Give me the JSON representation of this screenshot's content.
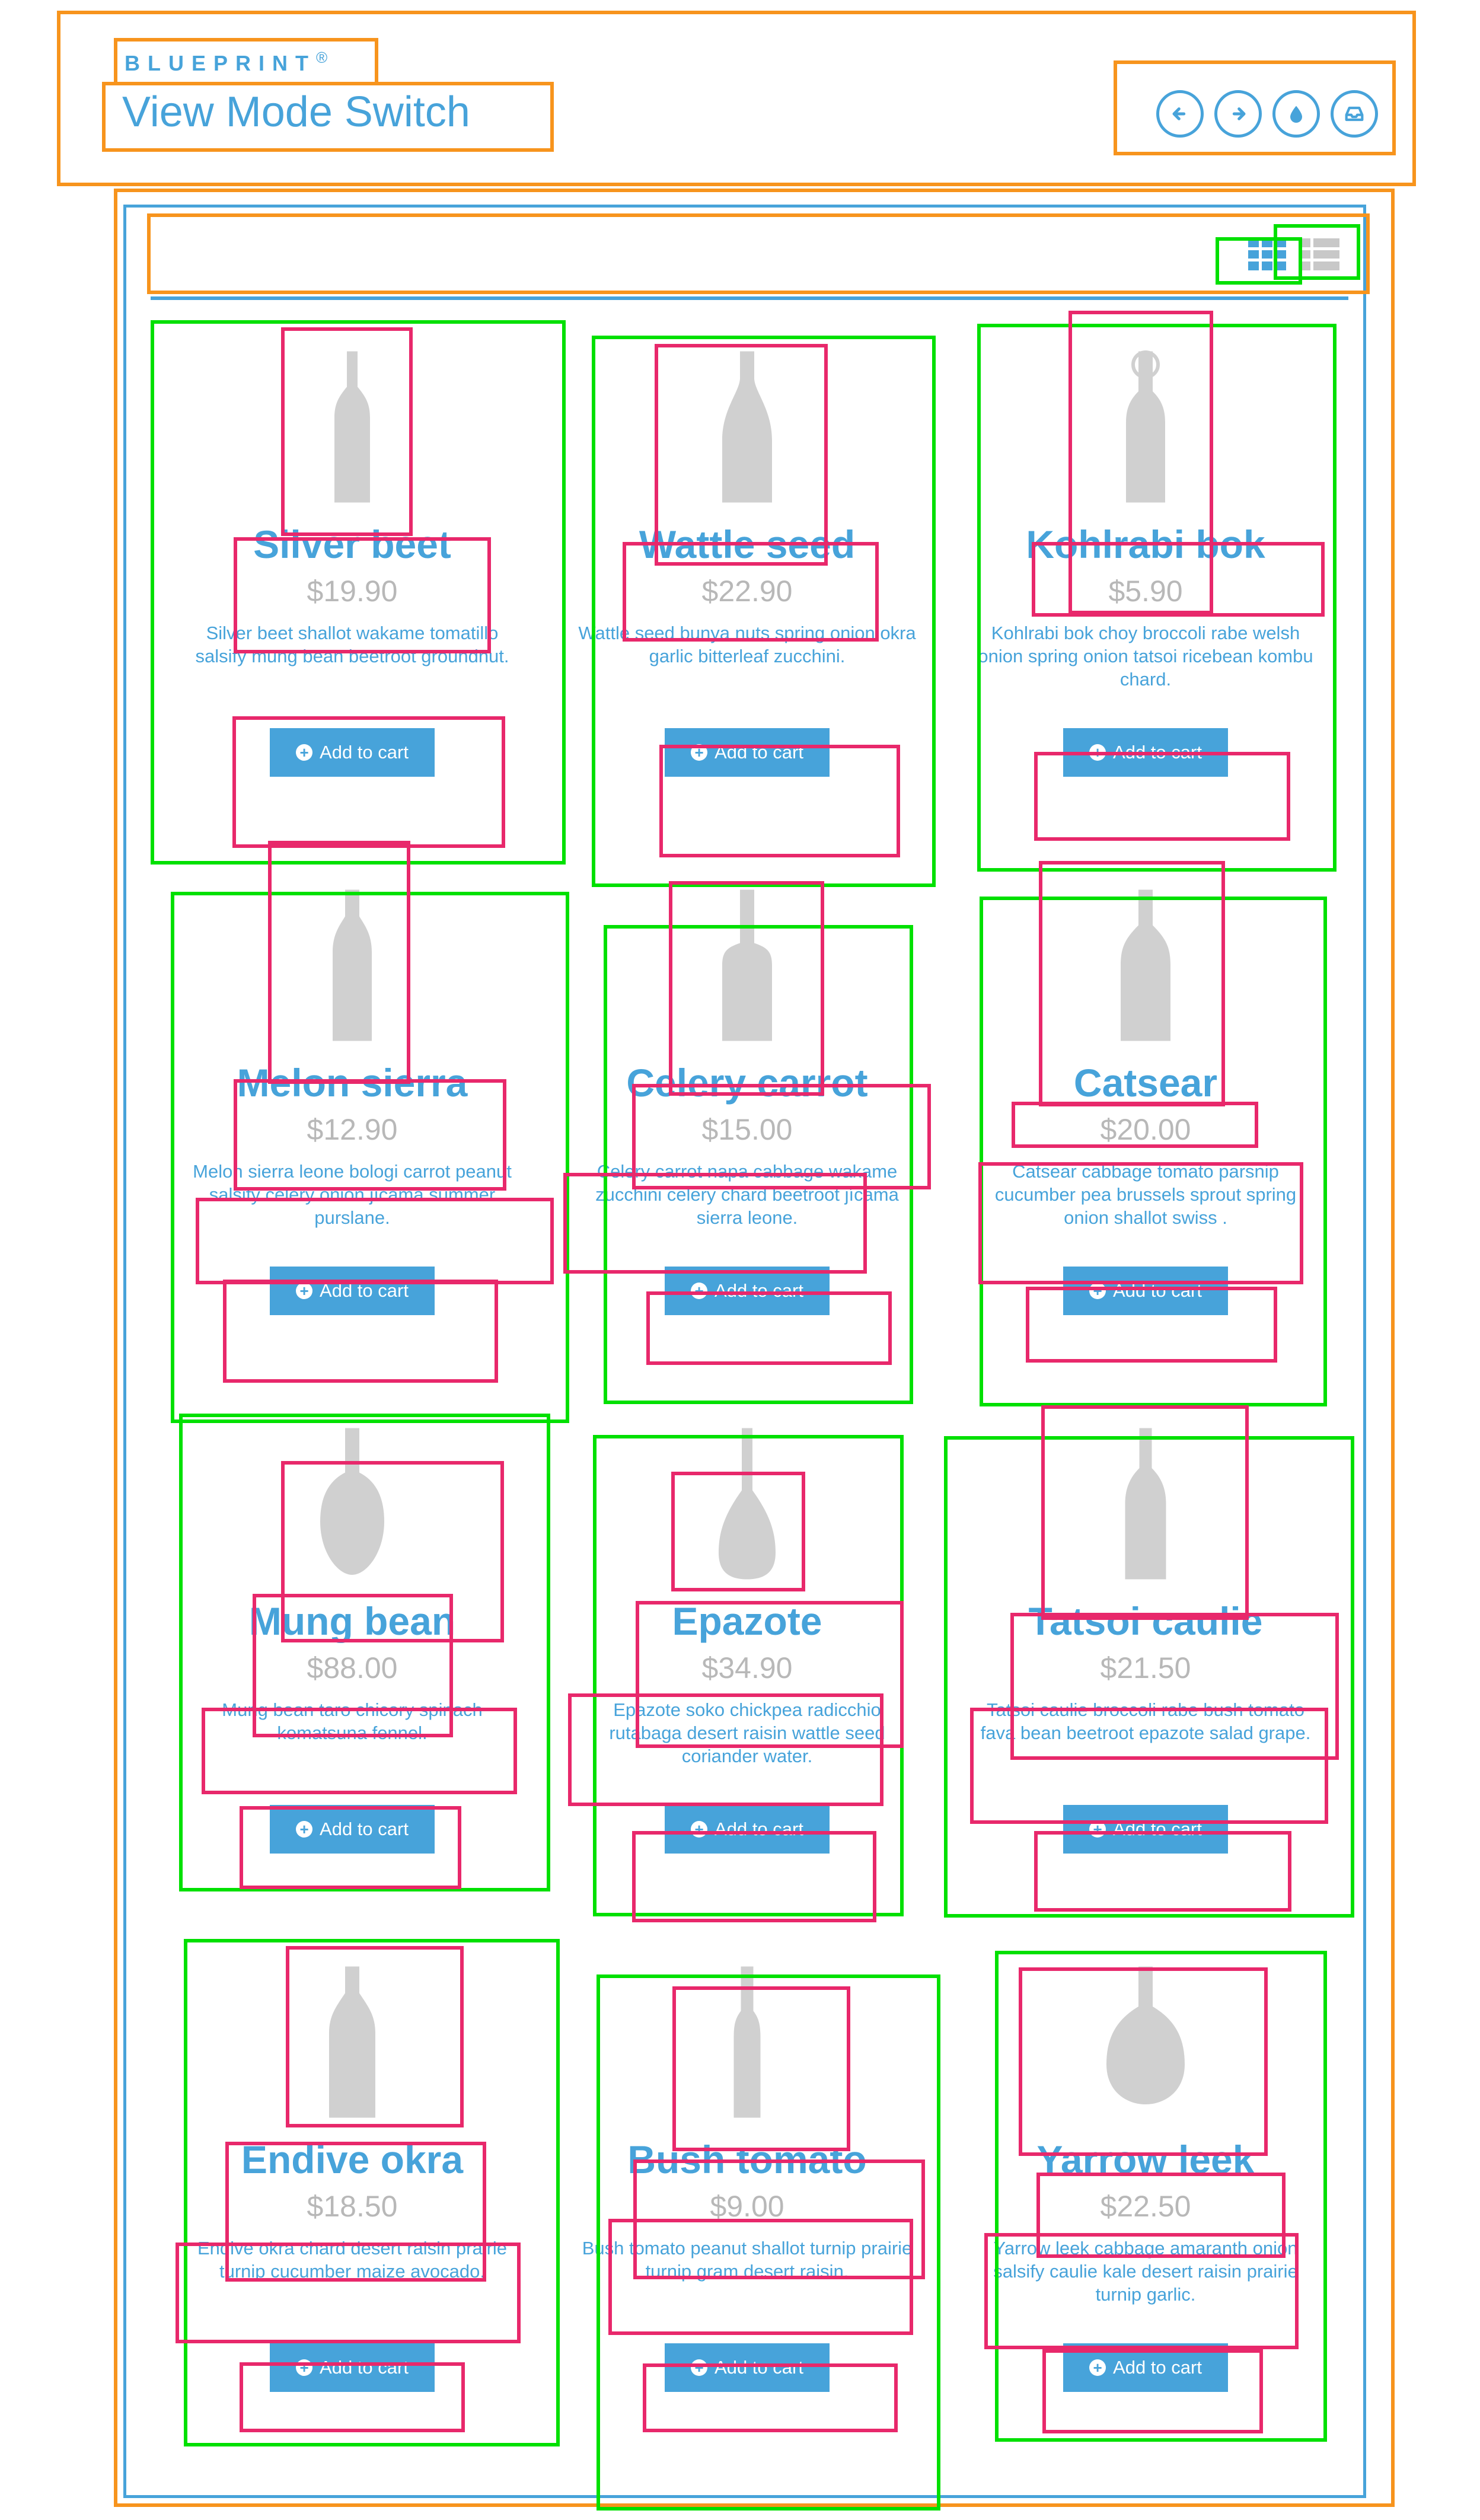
{
  "header": {
    "brand": "BLUEPRINT",
    "brand_mark": "®",
    "title": "View Mode Switch",
    "nav_icons": [
      "arrow-left-icon",
      "arrow-right-icon",
      "drop-icon",
      "inbox-icon"
    ]
  },
  "view_switch": {
    "active": "grid",
    "options": [
      "grid-view-icon",
      "list-view-icon"
    ]
  },
  "colors": {
    "accent": "#47a3da",
    "price": "#b8b8b8",
    "bottle": "#d0d0d0"
  },
  "products": [
    {
      "name": "Silver beet",
      "price": "$19.90",
      "desc": "Silver beet shallot wakame tomatillo salsify mung bean beetroot groundnut.",
      "button": "Add to cart"
    },
    {
      "name": "Wattle seed",
      "price": "$22.90",
      "desc": "Wattle seed bunya nuts spring onion okra garlic bitterleaf zucchini.",
      "button": "Add to cart"
    },
    {
      "name": "Kohlrabi bok",
      "price": "$5.90",
      "desc": "Kohlrabi bok choy broccoli rabe welsh onion spring onion tatsoi ricebean kombu chard.",
      "button": "Add to cart"
    },
    {
      "name": "Melon sierra",
      "price": "$12.90",
      "desc": "Melon sierra leone bologi carrot peanut salsify celery onion jícama summer purslane.",
      "button": "Add to cart"
    },
    {
      "name": "Celery carrot",
      "price": "$15.00",
      "desc": "Celery carrot napa cabbage wakame zucchini celery chard beetroot jícama sierra leone.",
      "button": "Add to cart"
    },
    {
      "name": "Catsear",
      "price": "$20.00",
      "desc": "Catsear cabbage tomato parsnip cucumber pea brussels sprout spring onion shallot swiss .",
      "button": "Add to cart"
    },
    {
      "name": "Mung bean",
      "price": "$88.00",
      "desc": "Mung bean taro chicory spinach komatsuna fennel.",
      "button": "Add to cart"
    },
    {
      "name": "Epazote",
      "price": "$34.90",
      "desc": "Epazote soko chickpea radicchio rutabaga desert raisin wattle seed coriander water.",
      "button": "Add to cart"
    },
    {
      "name": "Tatsoi caulie",
      "price": "$21.50",
      "desc": "Tatsoi caulie broccoli rabe bush tomato fava bean beetroot epazote salad grape.",
      "button": "Add to cart"
    },
    {
      "name": "Endive okra",
      "price": "$18.50",
      "desc": "Endive okra chard desert raisin prairie turnip cucumber maize avocado.",
      "button": "Add to cart"
    },
    {
      "name": "Bush tomato",
      "price": "$9.00",
      "desc": "Bush tomato peanut shallot turnip prairie turnip gram desert raisin.",
      "button": "Add to cart"
    },
    {
      "name": "Yarrow leek",
      "price": "$22.50",
      "desc": "Yarrow leek cabbage amaranth onion salsify caulie kale desert raisin prairie turnip garlic.",
      "button": "Add to cart"
    }
  ]
}
